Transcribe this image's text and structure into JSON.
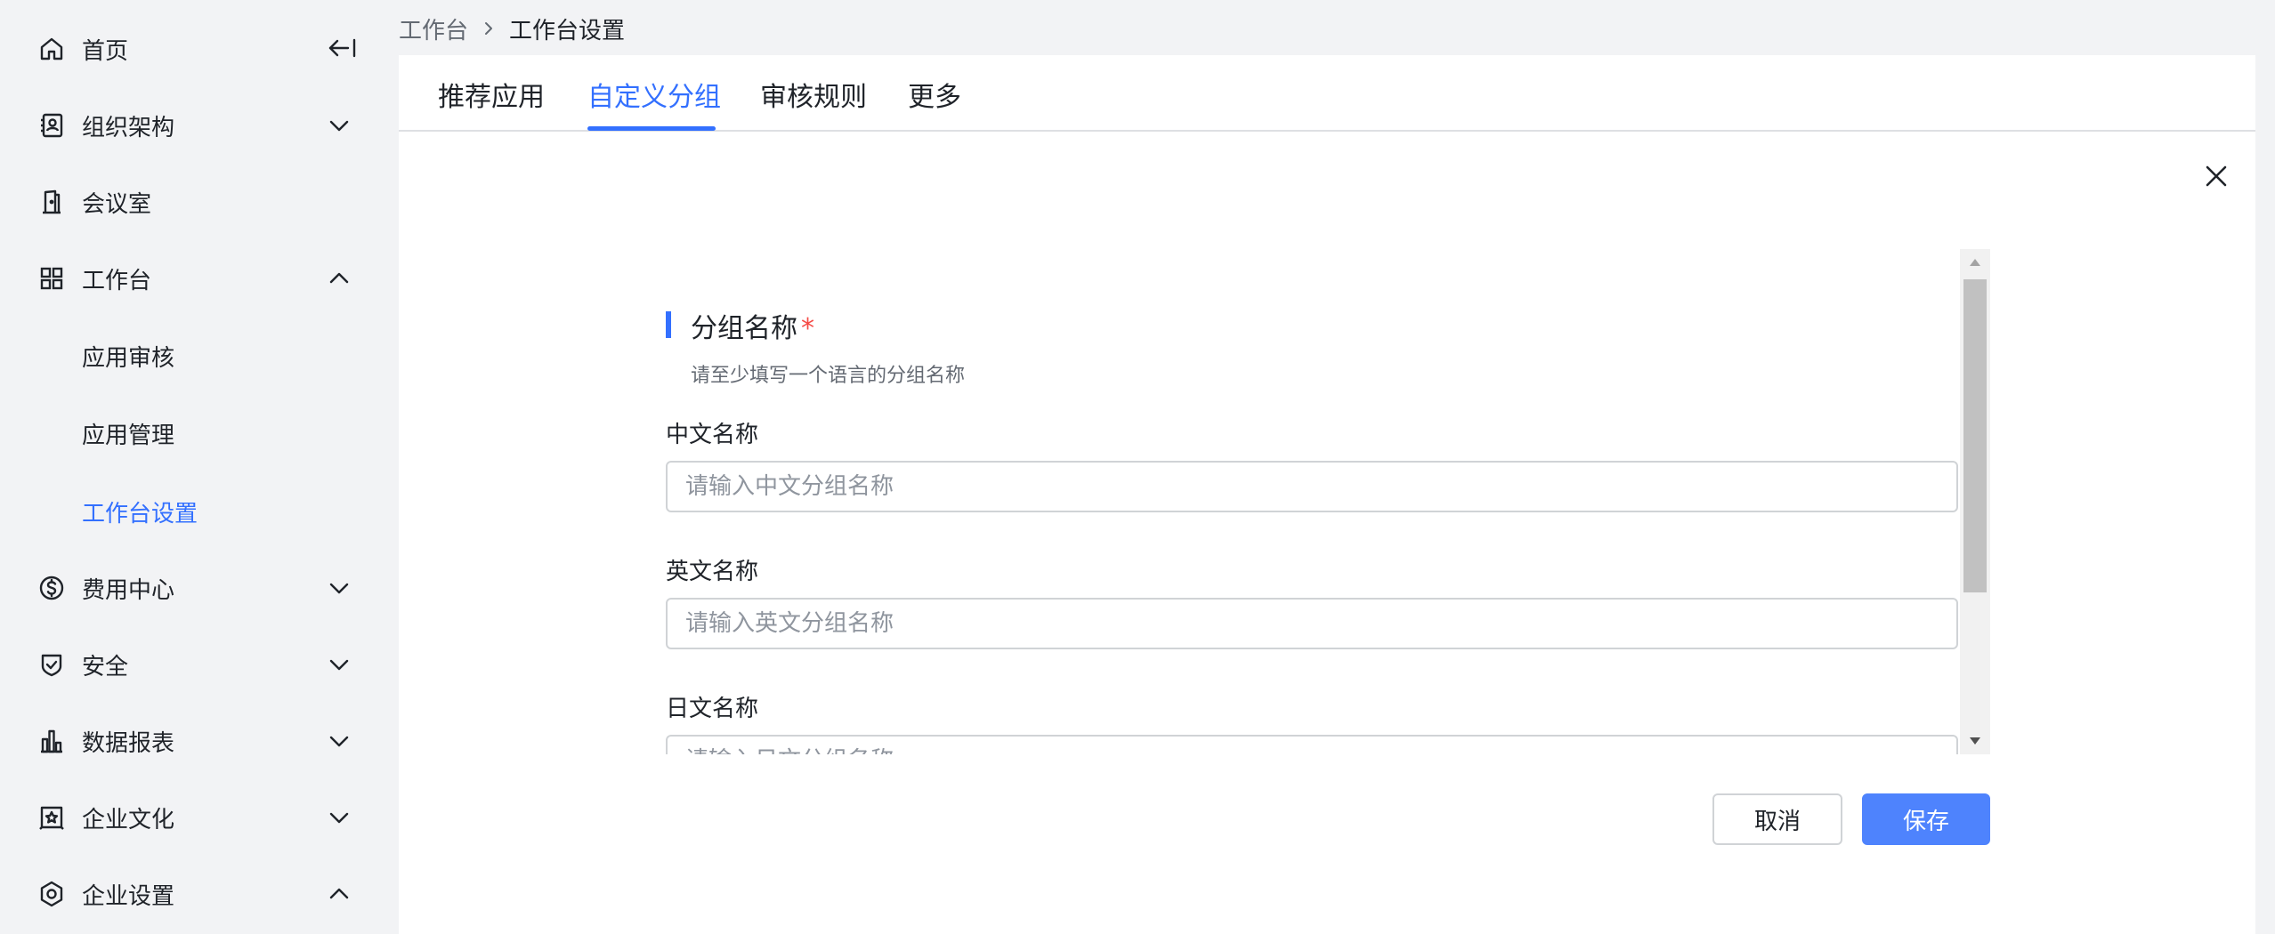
{
  "sidebar": {
    "items": [
      {
        "label": "首页",
        "icon": "home-icon"
      },
      {
        "label": "组织架构",
        "icon": "contacts-book-icon",
        "chevron": "down"
      },
      {
        "label": "会议室",
        "icon": "door-icon"
      },
      {
        "label": "工作台",
        "icon": "grid-icon",
        "chevron": "up",
        "expanded": true
      },
      {
        "label": "应用审核",
        "sub": true
      },
      {
        "label": "应用管理",
        "sub": true
      },
      {
        "label": "工作台设置",
        "sub": true,
        "active": true
      },
      {
        "label": "费用中心",
        "icon": "dollar-circle-icon",
        "chevron": "down"
      },
      {
        "label": "安全",
        "icon": "shield-check-icon",
        "chevron": "down"
      },
      {
        "label": "数据报表",
        "icon": "bar-chart-icon",
        "chevron": "down"
      },
      {
        "label": "企业文化",
        "icon": "star-frame-icon",
        "chevron": "down"
      },
      {
        "label": "企业设置",
        "icon": "hexagon-settings-icon",
        "chevron": "up"
      }
    ]
  },
  "breadcrumb": {
    "parent": "工作台",
    "current": "工作台设置"
  },
  "tabs": [
    {
      "label": "推荐应用"
    },
    {
      "label": "自定义分组",
      "active": true
    },
    {
      "label": "审核规则"
    },
    {
      "label": "更多"
    }
  ],
  "form": {
    "section_title": "分组名称",
    "required_mark": "*",
    "hint": "请至少填写一个语言的分组名称",
    "fields": [
      {
        "label": "中文名称",
        "placeholder": "请输入中文分组名称",
        "value": ""
      },
      {
        "label": "英文名称",
        "placeholder": "请输入英文分组名称",
        "value": ""
      },
      {
        "label": "日文名称",
        "placeholder": "请输入日文分组名称",
        "value": ""
      }
    ]
  },
  "buttons": {
    "cancel": "取消",
    "save": "保存"
  },
  "colors": {
    "accent": "#3370ff",
    "primary_button": "#4e83fd",
    "required": "#f54a45",
    "sidebar_bg": "#f2f3f5"
  }
}
